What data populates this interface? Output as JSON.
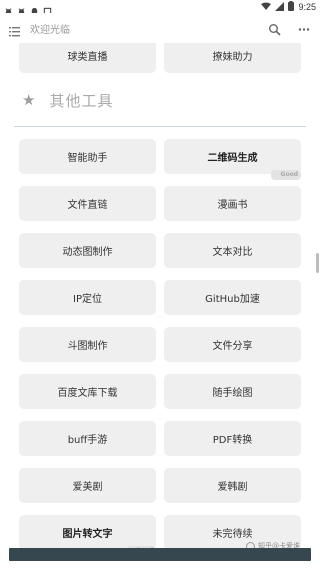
{
  "status_bar": {
    "time": "9:25",
    "left_icons": [
      "bug-icon",
      "bug-icon",
      "ghost-icon",
      "square-icon"
    ],
    "right_icons": [
      "wifi-icon",
      "signal-icon",
      "battery-icon"
    ]
  },
  "app_bar": {
    "title": "欢迎光临"
  },
  "top_buttons": [
    {
      "label": "球类直播"
    },
    {
      "label": "撩妹助力"
    }
  ],
  "section": {
    "title": "其他工具"
  },
  "tools": [
    {
      "label": "智能助手",
      "bold": false,
      "tag": ""
    },
    {
      "label": "二维码生成",
      "bold": true,
      "tag": "Good"
    },
    {
      "label": "文件直链",
      "bold": false,
      "tag": ""
    },
    {
      "label": "漫画书",
      "bold": false,
      "tag": ""
    },
    {
      "label": "动态图制作",
      "bold": false,
      "tag": ""
    },
    {
      "label": "文本对比",
      "bold": false,
      "tag": ""
    },
    {
      "label": "IP定位",
      "bold": false,
      "tag": ""
    },
    {
      "label": "GitHub加速",
      "bold": false,
      "tag": ""
    },
    {
      "label": "斗图制作",
      "bold": false,
      "tag": ""
    },
    {
      "label": "文件分享",
      "bold": false,
      "tag": ""
    },
    {
      "label": "百度文库下载",
      "bold": false,
      "tag": ""
    },
    {
      "label": "随手绘图",
      "bold": false,
      "tag": ""
    },
    {
      "label": "buff手游",
      "bold": false,
      "tag": ""
    },
    {
      "label": "PDF转换",
      "bold": false,
      "tag": ""
    },
    {
      "label": "爱美剧",
      "bold": false,
      "tag": ""
    },
    {
      "label": "爱韩剧",
      "bold": false,
      "tag": ""
    },
    {
      "label": "图片转文字",
      "bold": true,
      "tag": "Good"
    },
    {
      "label": "未完待续",
      "bold": false,
      "tag": ""
    }
  ],
  "watermark": {
    "text": "知乎@卡爱谁"
  },
  "colors": {
    "button_bg": "#efefef",
    "nav_bar": "#37474f",
    "section_text": "#aaaaaa"
  }
}
